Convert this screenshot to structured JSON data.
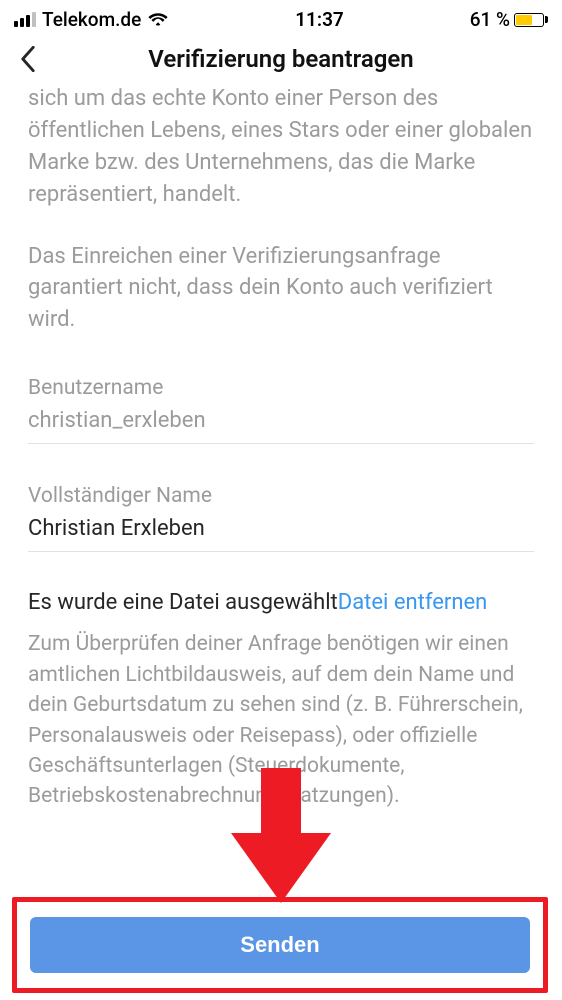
{
  "status": {
    "carrier": "Telekom.de",
    "time": "11:37",
    "battery_text": "61 %"
  },
  "nav": {
    "title": "Verifizierung beantragen"
  },
  "intro": {
    "p1": "sich um das echte Konto einer Person des öffentlichen Lebens, eines Stars oder einer globalen Marke bzw. des Unternehmens, das die Marke repräsentiert, handelt.",
    "p2": "Das Einreichen einer Verifizierungsanfrage garantiert nicht, dass dein Konto auch verifiziert wird."
  },
  "fields": {
    "username_label": "Benutzername",
    "username_value": "christian_erxleben",
    "fullname_label": "Vollständiger Name",
    "fullname_value": "Christian Erxleben"
  },
  "file": {
    "selected": "Es wurde eine Datei ausgewählt",
    "remove": "Datei entfernen",
    "hint": "Zum Überprüfen deiner Anfrage benötigen wir einen amtlichen Lichtbildausweis, auf dem dein Name und dein Geburtsdatum zu sehen sind (z. B. Führerschein, Personalausweis oder Reisepass), oder offizielle Geschäftsunterlagen (Steuerdokumente, Betriebskostenabrechnung, Satzungen)."
  },
  "submit": {
    "label": "Senden"
  }
}
